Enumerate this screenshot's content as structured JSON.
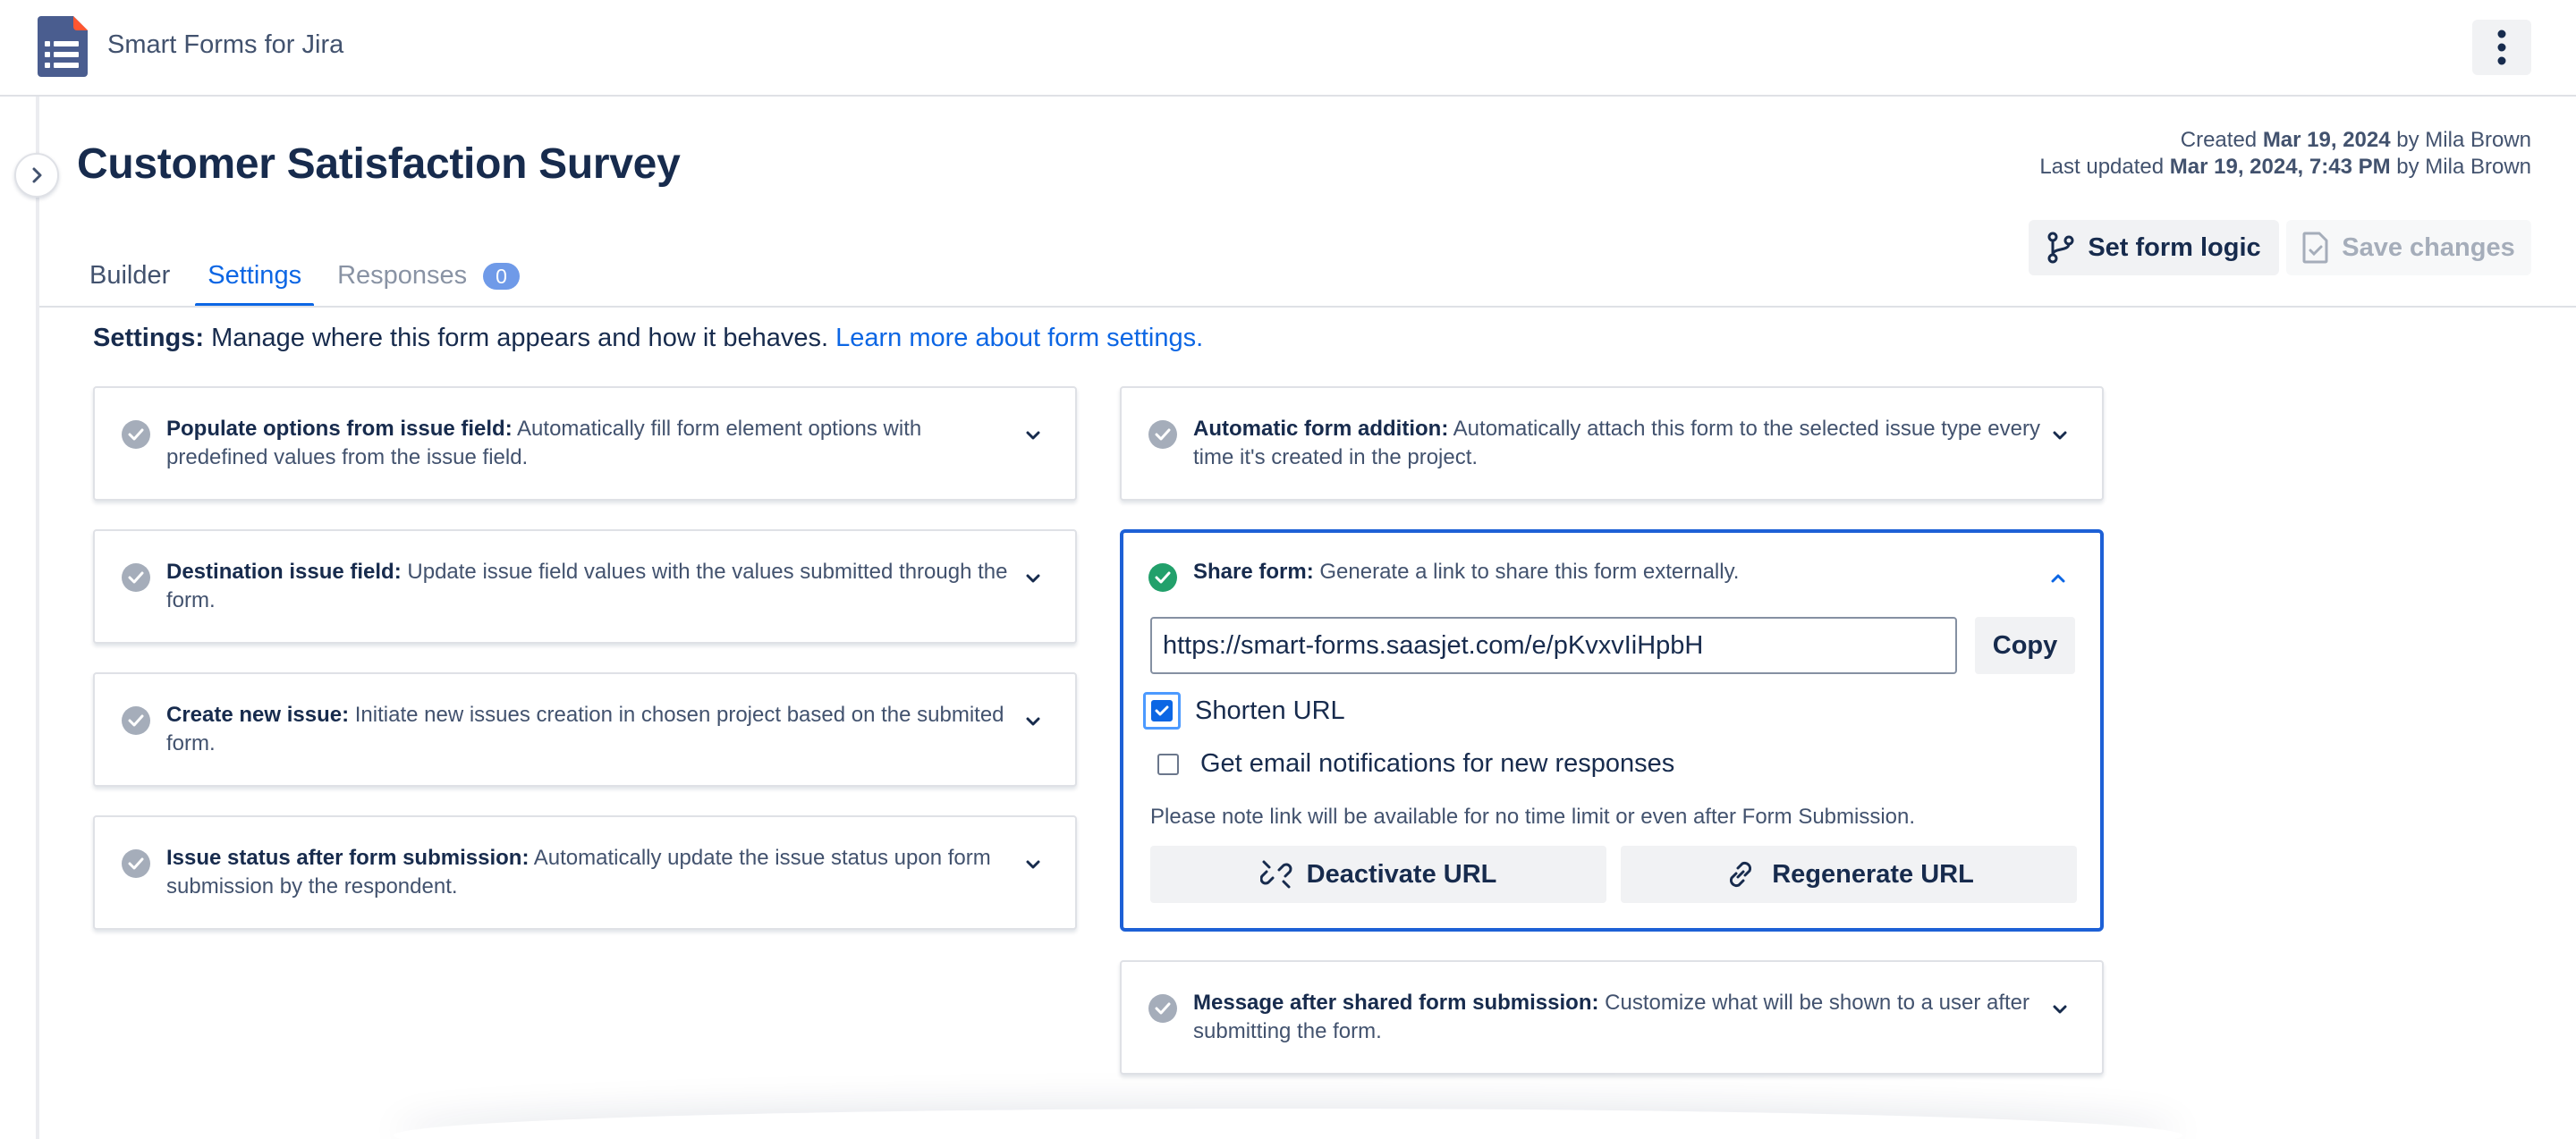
{
  "app": {
    "title": "Smart Forms for Jira"
  },
  "page": {
    "title": "Customer Satisfaction Survey",
    "created_label": "Created",
    "created_date": "Mar 19, 2024",
    "created_by_prefix": "by",
    "created_by": "Mila Brown",
    "updated_label": "Last updated",
    "updated_date": "Mar 19, 2024, 7:43 PM",
    "updated_by_prefix": "by",
    "updated_by": "Mila Brown"
  },
  "tabs": [
    {
      "label": "Builder",
      "active": false
    },
    {
      "label": "Settings",
      "active": true
    },
    {
      "label": "Responses",
      "active": false,
      "badge": "0"
    }
  ],
  "toolbar": {
    "set_logic_label": "Set form logic",
    "save_label": "Save changes"
  },
  "intro": {
    "heading": "Settings:",
    "text": " Manage where this form appears and how it behaves. ",
    "link": "Learn more about form settings."
  },
  "cards_left": [
    {
      "title": "Populate options from issue field:",
      "desc": " Automatically fill form element options with predefined values from the issue field."
    },
    {
      "title": "Destination issue field:",
      "desc": " Update issue field values with the values submitted through the form."
    },
    {
      "title": "Create new issue:",
      "desc": " Initiate new issues creation in chosen project based on the submited form."
    },
    {
      "title": "Issue status after form submission:",
      "desc": " Automatically update the issue status upon form submission by the respondent."
    }
  ],
  "cards_right": [
    {
      "title": "Automatic form addition:",
      "desc": " Automatically attach this form to the selected issue type every time it's created in the project."
    },
    {
      "title": "Message after shared form submission:",
      "desc": " Customize what will be shown to a user after submitting the form."
    }
  ],
  "share": {
    "title": "Share form:",
    "desc": " Generate a link to share this form externally.",
    "url": "https://smart-forms.saasjet.com/e/pKvxvIiHpbH",
    "copy_label": "Copy",
    "shorten_label": "Shorten URL",
    "shorten_checked": true,
    "notify_label": "Get email notifications for new responses",
    "notify_checked": false,
    "note": "Please note link will be available for no time limit or even after Form Submission.",
    "deactivate_label": "Deactivate URL",
    "regenerate_label": "Regenerate URL"
  },
  "colors": {
    "accent": "#0c66e4",
    "share_border": "#1d60d6",
    "success": "#22a06b",
    "badge": "#6f9ae8"
  }
}
